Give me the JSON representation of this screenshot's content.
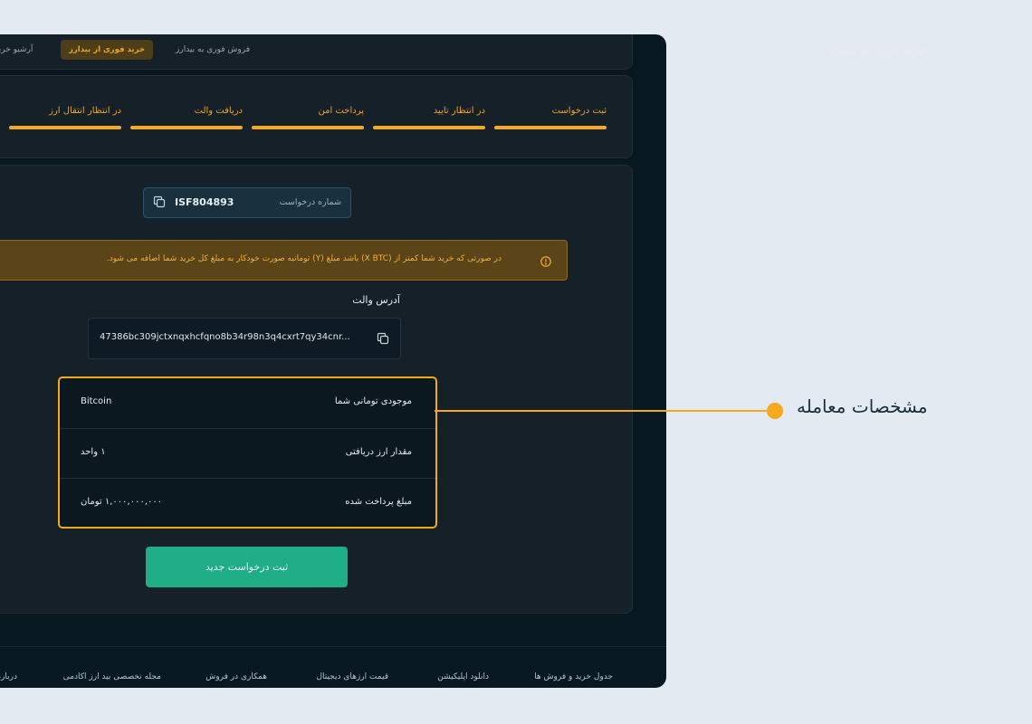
{
  "header": {
    "title": "خرید فوری به بیدارز",
    "tabs": {
      "sell": "فروش فوری به بیدارز",
      "buy": "خرید فوری از بیدارز",
      "archive": "آرشیو خرید"
    }
  },
  "steps": [
    {
      "label": "ثبت درخواست"
    },
    {
      "label": "در انتظار تایید"
    },
    {
      "label": "پرداخت امن"
    },
    {
      "label": "دریافت والت"
    },
    {
      "label": "در انتظار انتقال ارز"
    }
  ],
  "request": {
    "label": "شماره درخواست",
    "value": "ISF804893"
  },
  "warning": {
    "text": "در صورتی که خرید شما کمتر از (X BTC) باشد مبلغ (Y) تومانبه صورت خودکار به مبلغ کل خرید شما اضافه می شود."
  },
  "wallet": {
    "label": "آدرس والت",
    "value": "47386bc309jctxnqxhcfqno8b34r98n3q4cxrt7qy34cnr..."
  },
  "details": [
    {
      "label": "موجودی تومانی شما",
      "value": "Bitcoin"
    },
    {
      "label": "مقدار ارز دریافتی",
      "value": "۱ واحد"
    },
    {
      "label": "مبلغ پرداخت شده",
      "value": "۱,۰۰۰,۰۰۰,۰۰۰ تومان"
    }
  ],
  "new_request_button": "ثبت درخواست جدید",
  "footer": {
    "links": [
      "جدول خرید و فروش ها",
      "دانلود اپلیکیشن",
      "قیمت ارزهای دیجیتال",
      "همکاری در فروش",
      "مجله تخصصی بید ارز اکادمی",
      "درباره"
    ]
  },
  "annotation": {
    "label": "مشخصات معامله"
  },
  "colors": {
    "accent": "#f5a91c",
    "panel_bg": "#081820",
    "card_bg": "#162028",
    "success": "#1fad86",
    "page_bg": "#e3eaf2"
  }
}
